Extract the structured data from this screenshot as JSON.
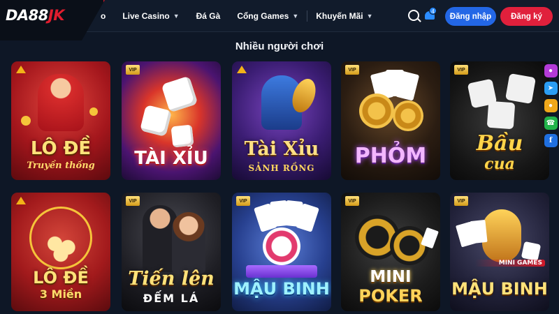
{
  "header": {
    "logo_left": "DA88",
    "logo_right": "JK",
    "nav_first_partial": "o",
    "nav": [
      {
        "label": "Live Casino",
        "has_chevron": true
      },
      {
        "label": "Đá Gà",
        "has_chevron": false
      },
      {
        "label": "Cổng Games",
        "has_chevron": true
      },
      {
        "label": "Khuyến Mãi",
        "has_chevron": true
      }
    ],
    "notification_count": "4",
    "login_label": "Đăng nhập",
    "register_label": "Đăng ký"
  },
  "section_title": "Nhiều người chơi",
  "games": [
    {
      "title": "LÔ ĐỀ",
      "subtitle": "Truyền thống",
      "badge": "triangle"
    },
    {
      "title": "TÀI XỈU",
      "subtitle": "",
      "badge": "vip"
    },
    {
      "title": "Tài Xỉu",
      "subtitle": "SẢNH RỒNG",
      "badge": "triangle"
    },
    {
      "title": "PHỎM",
      "subtitle": "",
      "badge": "vip"
    },
    {
      "title": "Bầu",
      "subtitle": "cua",
      "badge": "vip"
    },
    {
      "title": "LÔ ĐỀ",
      "subtitle": "3 Miền",
      "badge": "triangle"
    },
    {
      "title": "Tiến lên",
      "subtitle": "ĐẾM LÁ",
      "badge": "vip"
    },
    {
      "title": "MẬU BINH",
      "subtitle": "",
      "badge": "vip"
    },
    {
      "title": "MINI",
      "subtitle": "POKER",
      "badge": "vip"
    },
    {
      "title": "MẬU BINH",
      "subtitle": "MINI GAMES",
      "badge": "vip"
    }
  ],
  "badge_text": "VIP",
  "social": [
    "messenger-icon",
    "telegram-icon",
    "zalo-icon",
    "phone-icon",
    "facebook-icon"
  ],
  "colors": {
    "background": "#0e1726",
    "login": "#2367e6",
    "register": "#e0203c",
    "brand_red": "#e11d2e"
  }
}
